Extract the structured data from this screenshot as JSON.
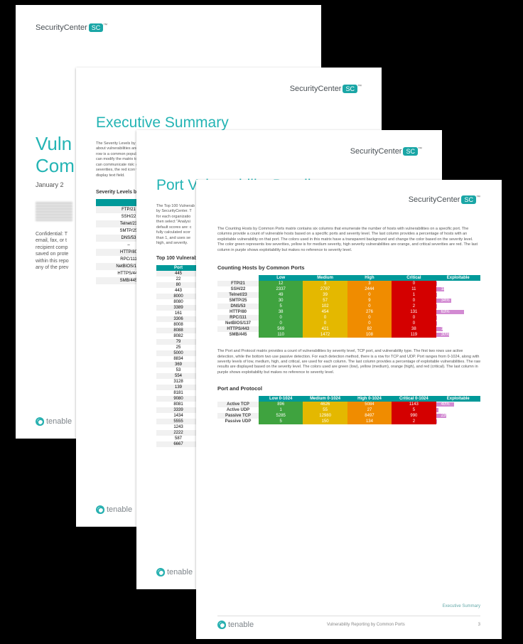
{
  "brand": {
    "name": "SecurityCenter",
    "badge": "SC",
    "tm": "™",
    "footer_brand": "tenable"
  },
  "page1": {
    "title_line1": "Vuln",
    "title_line2": "Com",
    "date_frag": "January 2",
    "conf_frag": "Confidential: T\nemail, fax, or t\nrecipient comp\nsaved on prote\nwithin this repo\nany of the prev"
  },
  "page2": {
    "title": "Executive Summary",
    "intro_frag": "The Severity Levels by Co\nabout vulnerabilities and ri\nrow is a common popular p\ncan modify the matrix to us\ncan communicate risk: gre\nseverities, the red icon with\ndisplay text field.",
    "table_title": "Severity Levels by Con",
    "rows": [
      "FTP/21",
      "SSH/22",
      "Telnet/23",
      "SMTP/25",
      "DNS/53",
      "–",
      "HTTP/80",
      "RPC/111",
      "NetBIOS/137",
      "HTTPS/443",
      "SMB/445"
    ]
  },
  "page3": {
    "title": "Port Vulnerability Details",
    "intro_frag": "The Top 100 Vulnerab\nby SecurityCenter. T\nfor each organizatio\nthen select \"Analysi\ndefault scores are: c\nfully calculated scor\nthan 1, and uses se\nhigh, and severity.",
    "table_title": "Top 100 Vulnerabl",
    "port_header": "Port",
    "ports": [
      "445",
      "22",
      "80",
      "443",
      "8000",
      "8080",
      "3389",
      "161",
      "3306",
      "8008",
      "8088",
      "8082",
      "79",
      "25",
      "5000",
      "8834",
      "369",
      "53",
      "554",
      "3128",
      "139",
      "8181",
      "9080",
      "8081",
      "3339",
      "1434",
      "5555",
      "1243",
      "2222",
      "587",
      "6667"
    ]
  },
  "page4": {
    "intro": "The Counting Hosts by Common Ports matrix contains six columns that enumerate the number of hosts with vulnerabilities on a specific port. The columns provide a count of vulnerable hosts based on a specific ports and severity level. The last column provides a percentage of hosts with an exploitable vulnerability on that port. The colors used in this matrix have a transparent background and change the color based on the severity level. The color green represents low severities, yellow is for medium severity, high severity vulnerabilities are orange, and critical severities are red. The last column in purple shows exploitability but makes no reference to severity level.",
    "chart1_title": "Counting Hosts by Common Ports",
    "intro2": "The Port and Protocol matrix provides a count of vulnerabilities by severity level, TCP port, and vulnerability type. The first two rows use active detection, while the bottom two use passive detection. For each detection method, there is a row for TCP and UDP. Port ranges from 0-1024, along with severity levels of low, medium, high, and critical, are used for each column. The last column provides a percentage of exploitable vulnerabilities. The raw results are displayed based on the severity level. The colors used are green (low), yellow (medium), orange (high), and red (critical). The last column in purple shows exploitability but makes no reference to severity level.",
    "chart2_title": "Port and Protocol",
    "footer_center": "Vulnerability Reporting by Common Ports",
    "footer_section": "Executive Summary",
    "footer_page": "3"
  },
  "chart_data": [
    {
      "type": "table",
      "title": "Counting Hosts by Common Ports",
      "columns": [
        "",
        "Low",
        "Medium",
        "High",
        "Critical",
        "Exploitable"
      ],
      "rows": [
        {
          "label": "FTP/21",
          "low": 12,
          "medium": 3,
          "high": 3,
          "critical": 0,
          "exploitable_pct": 2
        },
        {
          "label": "SSH/22",
          "low": 2337,
          "medium": 2787,
          "high": 2444,
          "critical": 11,
          "exploitable_pct": 18
        },
        {
          "label": "Telnet/23",
          "low": 49,
          "medium": 39,
          "high": 0,
          "critical": 1,
          "exploitable_pct": 2
        },
        {
          "label": "SMTP/25",
          "low": 30,
          "medium": 57,
          "high": 9,
          "critical": 0,
          "exploitable_pct": 34
        },
        {
          "label": "DNS/53",
          "low": 5,
          "medium": 102,
          "high": 0,
          "critical": 2,
          "exploitable_pct": 2
        },
        {
          "label": "HTTP/80",
          "low": 38,
          "medium": 454,
          "high": 276,
          "critical": 131,
          "exploitable_pct": 63
        },
        {
          "label": "RPC/111",
          "low": 0,
          "medium": 0,
          "high": 0,
          "critical": 0,
          "exploitable_pct": 1
        },
        {
          "label": "NetBIOS/137",
          "low": 0,
          "medium": 0,
          "high": 0,
          "critical": 0,
          "exploitable_pct": 1
        },
        {
          "label": "HTTPS/443",
          "low": 569,
          "medium": 421,
          "high": 82,
          "critical": 38,
          "exploitable_pct": 15
        },
        {
          "label": "SMB/445",
          "low": 110,
          "medium": 1472,
          "high": 108,
          "critical": 119,
          "exploitable_pct": 30
        }
      ]
    },
    {
      "type": "table",
      "title": "Port and Protocol",
      "columns": [
        "",
        "Low 0-1024",
        "Medium 0-1024",
        "High 0-1024",
        "Critical 0-1024",
        "Exploitable"
      ],
      "rows": [
        {
          "label": "Active TCP",
          "low": 896,
          "medium": 4626,
          "high": 5084,
          "critical": 1143,
          "exploitable_pct": 40
        },
        {
          "label": "Active UDP",
          "low": 1,
          "medium": 55,
          "high": 27,
          "critical": 5,
          "exploitable_pct": 5
        },
        {
          "label": "Passive TCP",
          "low": 5285,
          "medium": 12980,
          "high": 8497,
          "critical": 990,
          "exploitable_pct": 23
        },
        {
          "label": "Passive UDP",
          "low": 5,
          "medium": 150,
          "high": 134,
          "critical": 2,
          "exploitable_pct": 3
        }
      ]
    }
  ]
}
